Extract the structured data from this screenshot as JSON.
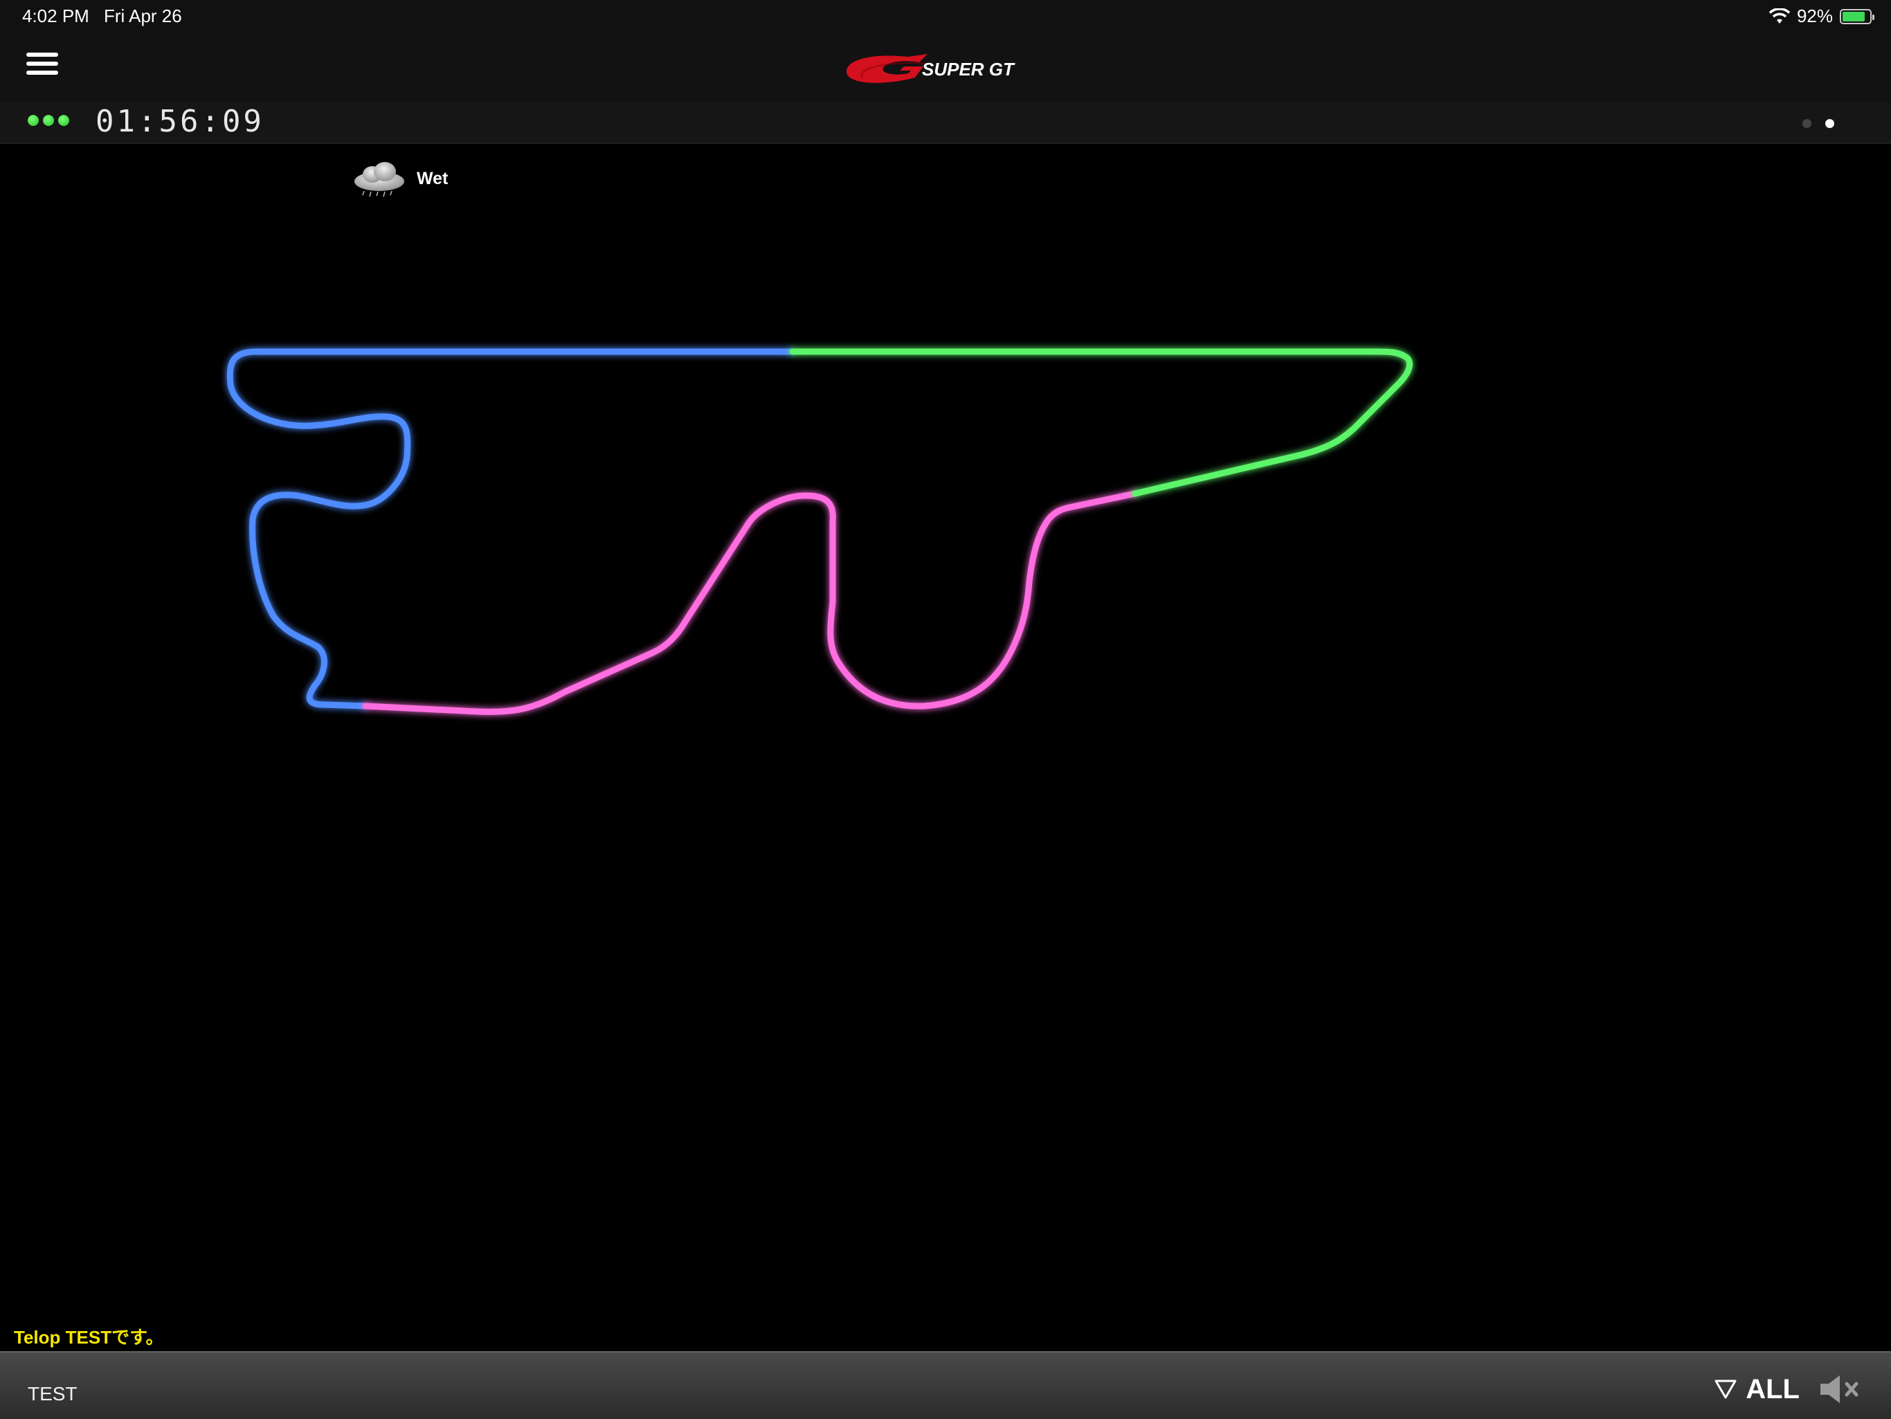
{
  "status_bar": {
    "time": "4:02 PM",
    "date": "Fri Apr 26",
    "battery": "92%"
  },
  "header": {
    "logo_text": "SUPER GT",
    "menu_icon": "hamburger-menu-icon"
  },
  "race": {
    "clock": "01:56:09",
    "signal_lights_color": "#22c422",
    "pages_total": 2,
    "active_page": 2
  },
  "weather": {
    "icon": "rain-cloud-icon",
    "label": "Wet"
  },
  "track": {
    "sectors": [
      {
        "sector": 1,
        "color": "#4f8cff"
      },
      {
        "sector": 2,
        "color": "#ff6ee0"
      },
      {
        "sector": 3,
        "color": "#5cf56a"
      }
    ]
  },
  "telop": "Telop TESTです。",
  "footer": {
    "label": "TEST",
    "filter_label": "ALL",
    "filter_icon": "triangle-down-icon",
    "sound_icon": "speaker-muted-icon"
  }
}
